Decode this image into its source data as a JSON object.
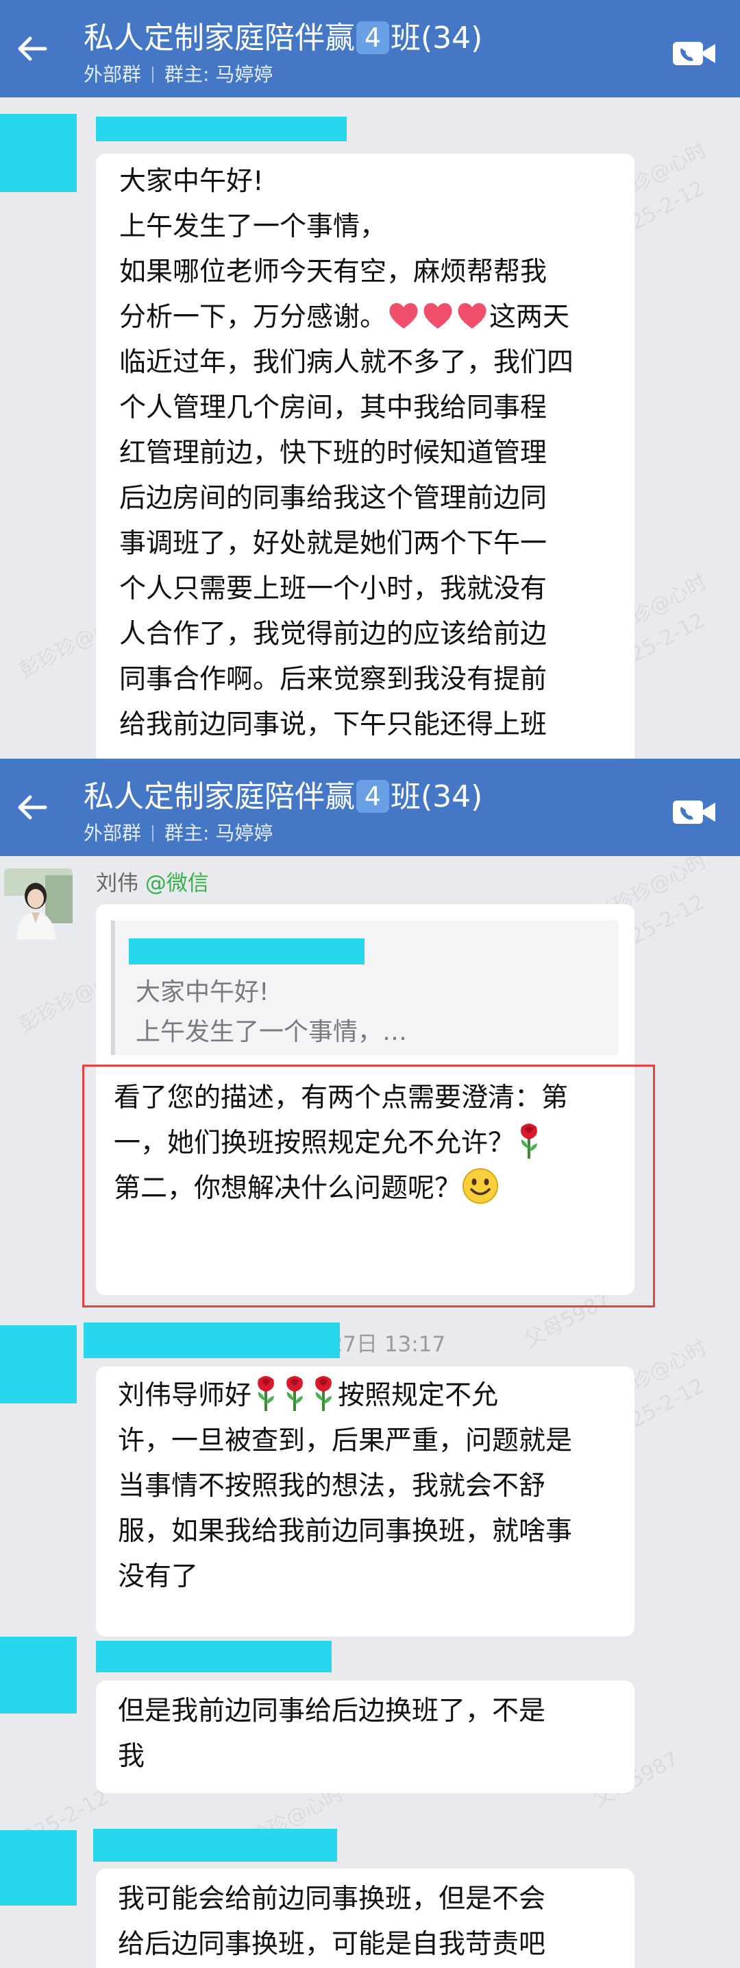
{
  "header": {
    "title_prefix": "私人定制家庭陪伴赢",
    "title_badge": "4",
    "title_suffix": "班(34)",
    "group_type": "外部群",
    "owner": "群主: 马婷婷"
  },
  "screen1": {
    "message": {
      "lines": [
        "大家中午好!",
        "上午发生了一个事情，",
        "如果哪位老师今天有空，麻烦帮帮我",
        "分析一下，万分感谢。",
        "临近过年，我们病人就不多了，我们四",
        "个人管理几个房间，其中我给同事程",
        "红管理前边，快下班的时候知道管理",
        "后边房间的同事给我这个管理前边同",
        "事调班了，好处就是她们两个下午一",
        "个人只需要上班一个小时，我就没有",
        "人合作了，我觉得前边的应该给前边",
        "同事合作啊。后来觉察到我没有提前",
        "给我前边同事说，下午只能还得上班"
      ],
      "line4_tail": "这两天",
      "emoji": "heart"
    }
  },
  "screen2": {
    "reply": {
      "sender": "刘伟",
      "sender_tag": "@微信",
      "quote_line1": "大家中午好!",
      "quote_line2": "上午发生了一个事情，…",
      "line1": "看了您的描述，有两个点需要澄清：第",
      "line2": "一，她们换班按照规定允不允许？",
      "line3": "第二，你想解决什么问题呢？",
      "emoji_rose": "rose",
      "emoji_smile": "smile"
    },
    "timestamp": "1月27日  13:17",
    "msg1": {
      "line1_a": "刘伟导师好",
      "line1_b": "按照规定不允",
      "line2": "许，一旦被查到，后果严重，问题就是",
      "line3": "当事情不按照我的想法，我就会不舒",
      "line4": "服，如果我给我前边同事换班，就啥事",
      "line5": "没有了"
    },
    "msg2": {
      "line1": "但是我前边同事给后边换班了，不是",
      "line2": "我"
    },
    "msg3": {
      "line1": "我可能会给前边同事换班，但是不会",
      "line2": "给后边同事换班，可能是自我苛责吧"
    }
  },
  "watermarks": [
    "彭珍珍@心时",
    "2025-2-12",
    "父母5987"
  ],
  "colors": {
    "header": "#4577c7",
    "background": "#e9eaee",
    "bubble": "#ffffff",
    "redaction": "#27d7ec",
    "highlight": "#e64040",
    "sender_tag": "#36b14a"
  }
}
